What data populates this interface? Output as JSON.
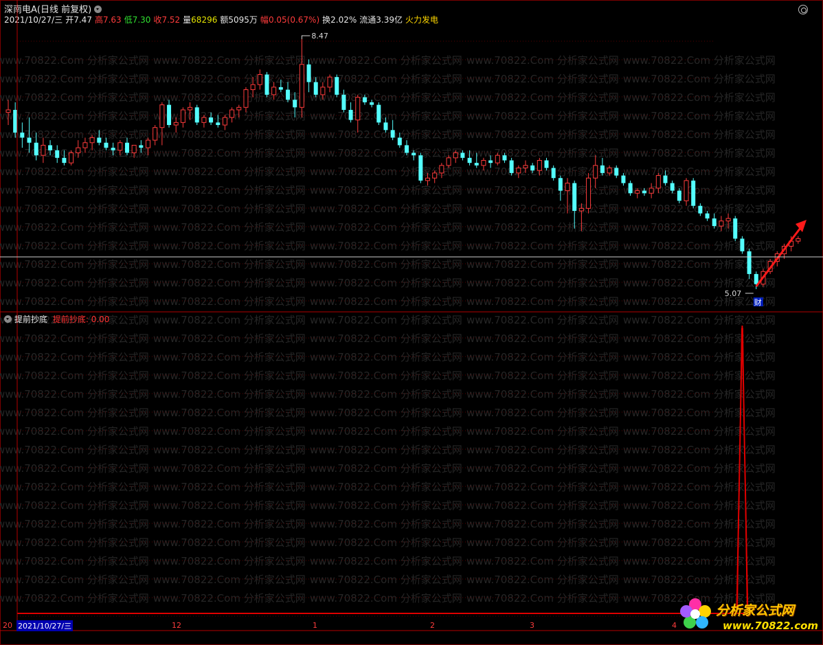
{
  "window": {
    "title": "深南电A(日线 前复权)"
  },
  "info_bar": {
    "date": "2021/10/27/三",
    "open_label": "开",
    "open": "7.47",
    "high_label": "高",
    "high": "7.63",
    "low_label": "低",
    "low": "7.30",
    "close_label": "收",
    "close": "7.52",
    "volume_label": "量",
    "volume": "68296",
    "amount_label": "额",
    "amount": "5095万",
    "change_label": "幅",
    "change": "0.05(0.67%)",
    "turnover_label": "换",
    "turnover": "2.02%",
    "float_label": "流通",
    "float_value": "3.39亿",
    "sector": "火力发电"
  },
  "price_chart": {
    "max_marker": "8.47",
    "min_marker": "5.07",
    "event_badge": "财"
  },
  "indicator": {
    "name": "提前抄底",
    "value_label": "提前抄底:",
    "value": "0.00"
  },
  "time_axis": {
    "cursor_date": "2021/10/27/三",
    "left_stub": "20",
    "month_labels": [
      "12",
      "1",
      "2",
      "3",
      "4"
    ]
  },
  "watermark": {
    "text": "www.70822.Com 分析家公式网"
  },
  "logo": {
    "brand": "分析家公式网",
    "url": "www.70822.com"
  },
  "colors": {
    "up": "#ff3c3c",
    "down": "#54ffff",
    "frame": "#b40000",
    "indicator_line": "#e00000"
  },
  "chart_data": {
    "type": "candlestick",
    "note_units": "price-chart y in price-scale units 0-100 (top=100); x in 0-1000 slots",
    "candles": [
      {
        "o": 68,
        "h": 73,
        "l": 63,
        "c": 69
      },
      {
        "o": 69,
        "h": 72,
        "l": 58,
        "c": 60
      },
      {
        "o": 60,
        "h": 64,
        "l": 54,
        "c": 58
      },
      {
        "o": 58,
        "h": 66,
        "l": 52,
        "c": 56
      },
      {
        "o": 56,
        "h": 60,
        "l": 49,
        "c": 51
      },
      {
        "o": 51,
        "h": 58,
        "l": 48,
        "c": 55
      },
      {
        "o": 55,
        "h": 57,
        "l": 51,
        "c": 53
      },
      {
        "o": 53,
        "h": 55,
        "l": 48,
        "c": 50
      },
      {
        "o": 50,
        "h": 53,
        "l": 47,
        "c": 48
      },
      {
        "o": 48,
        "h": 53,
        "l": 47,
        "c": 52
      },
      {
        "o": 52,
        "h": 57,
        "l": 50,
        "c": 54
      },
      {
        "o": 54,
        "h": 58,
        "l": 52,
        "c": 56
      },
      {
        "o": 56,
        "h": 59,
        "l": 53,
        "c": 58
      },
      {
        "o": 58,
        "h": 61,
        "l": 55,
        "c": 56
      },
      {
        "o": 56,
        "h": 58,
        "l": 53,
        "c": 54
      },
      {
        "o": 54,
        "h": 56,
        "l": 51,
        "c": 53
      },
      {
        "o": 53,
        "h": 57,
        "l": 51,
        "c": 56
      },
      {
        "o": 56,
        "h": 58,
        "l": 51,
        "c": 52
      },
      {
        "o": 52,
        "h": 55,
        "l": 50,
        "c": 55
      },
      {
        "o": 55,
        "h": 57,
        "l": 52,
        "c": 54
      },
      {
        "o": 54,
        "h": 58,
        "l": 51,
        "c": 57
      },
      {
        "o": 57,
        "h": 63,
        "l": 55,
        "c": 62
      },
      {
        "o": 62,
        "h": 72,
        "l": 55,
        "c": 71
      },
      {
        "o": 71,
        "h": 73,
        "l": 62,
        "c": 63
      },
      {
        "o": 63,
        "h": 66,
        "l": 60,
        "c": 64
      },
      {
        "o": 64,
        "h": 70,
        "l": 62,
        "c": 69
      },
      {
        "o": 69,
        "h": 72,
        "l": 65,
        "c": 70
      },
      {
        "o": 70,
        "h": 71,
        "l": 63,
        "c": 64
      },
      {
        "o": 64,
        "h": 67,
        "l": 62,
        "c": 66
      },
      {
        "o": 66,
        "h": 68,
        "l": 63,
        "c": 64
      },
      {
        "o": 64,
        "h": 67,
        "l": 62,
        "c": 63
      },
      {
        "o": 63,
        "h": 67,
        "l": 61,
        "c": 66
      },
      {
        "o": 66,
        "h": 70,
        "l": 64,
        "c": 69
      },
      {
        "o": 69,
        "h": 71,
        "l": 66,
        "c": 70
      },
      {
        "o": 70,
        "h": 78,
        "l": 68,
        "c": 77
      },
      {
        "o": 77,
        "h": 82,
        "l": 74,
        "c": 79
      },
      {
        "o": 79,
        "h": 85,
        "l": 77,
        "c": 83
      },
      {
        "o": 83,
        "h": 84,
        "l": 74,
        "c": 75
      },
      {
        "o": 75,
        "h": 80,
        "l": 73,
        "c": 78
      },
      {
        "o": 78,
        "h": 81,
        "l": 76,
        "c": 77
      },
      {
        "o": 77,
        "h": 80,
        "l": 72,
        "c": 73
      },
      {
        "o": 73,
        "h": 76,
        "l": 66,
        "c": 70
      },
      {
        "o": 70,
        "h": 97,
        "l": 66,
        "c": 87
      },
      {
        "o": 87,
        "h": 89,
        "l": 76,
        "c": 80
      },
      {
        "o": 80,
        "h": 82,
        "l": 74,
        "c": 75
      },
      {
        "o": 75,
        "h": 80,
        "l": 73,
        "c": 78
      },
      {
        "o": 78,
        "h": 83,
        "l": 76,
        "c": 82
      },
      {
        "o": 82,
        "h": 83,
        "l": 74,
        "c": 75
      },
      {
        "o": 75,
        "h": 77,
        "l": 68,
        "c": 69
      },
      {
        "o": 69,
        "h": 72,
        "l": 64,
        "c": 65
      },
      {
        "o": 65,
        "h": 75,
        "l": 60,
        "c": 74
      },
      {
        "o": 74,
        "h": 75,
        "l": 71,
        "c": 72
      },
      {
        "o": 72,
        "h": 73,
        "l": 70,
        "c": 71
      },
      {
        "o": 71,
        "h": 72,
        "l": 63,
        "c": 64
      },
      {
        "o": 64,
        "h": 66,
        "l": 60,
        "c": 61
      },
      {
        "o": 61,
        "h": 65,
        "l": 57,
        "c": 58
      },
      {
        "o": 58,
        "h": 60,
        "l": 54,
        "c": 55
      },
      {
        "o": 55,
        "h": 57,
        "l": 51,
        "c": 52
      },
      {
        "o": 52,
        "h": 53,
        "l": 49,
        "c": 51
      },
      {
        "o": 51,
        "h": 52,
        "l": 40,
        "c": 41
      },
      {
        "o": 41,
        "h": 44,
        "l": 39,
        "c": 42
      },
      {
        "o": 42,
        "h": 45,
        "l": 40,
        "c": 44
      },
      {
        "o": 44,
        "h": 48,
        "l": 42,
        "c": 47
      },
      {
        "o": 47,
        "h": 51,
        "l": 46,
        "c": 50
      },
      {
        "o": 50,
        "h": 53,
        "l": 48,
        "c": 52
      },
      {
        "o": 52,
        "h": 53,
        "l": 49,
        "c": 50
      },
      {
        "o": 50,
        "h": 53,
        "l": 47,
        "c": 48
      },
      {
        "o": 48,
        "h": 52,
        "l": 46,
        "c": 47
      },
      {
        "o": 47,
        "h": 50,
        "l": 45,
        "c": 49
      },
      {
        "o": 49,
        "h": 51,
        "l": 46,
        "c": 48
      },
      {
        "o": 48,
        "h": 52,
        "l": 47,
        "c": 51
      },
      {
        "o": 51,
        "h": 52,
        "l": 48,
        "c": 49
      },
      {
        "o": 49,
        "h": 50,
        "l": 43,
        "c": 44
      },
      {
        "o": 44,
        "h": 47,
        "l": 42,
        "c": 46
      },
      {
        "o": 46,
        "h": 49,
        "l": 44,
        "c": 47
      },
      {
        "o": 47,
        "h": 48,
        "l": 44,
        "c": 45
      },
      {
        "o": 45,
        "h": 50,
        "l": 43,
        "c": 49
      },
      {
        "o": 49,
        "h": 50,
        "l": 45,
        "c": 46
      },
      {
        "o": 46,
        "h": 47,
        "l": 41,
        "c": 42
      },
      {
        "o": 42,
        "h": 43,
        "l": 33,
        "c": 37
      },
      {
        "o": 37,
        "h": 42,
        "l": 28,
        "c": 40
      },
      {
        "o": 40,
        "h": 41,
        "l": 22,
        "c": 29
      },
      {
        "o": 29,
        "h": 32,
        "l": 21,
        "c": 30
      },
      {
        "o": 30,
        "h": 44,
        "l": 28,
        "c": 42
      },
      {
        "o": 42,
        "h": 51,
        "l": 38,
        "c": 47
      },
      {
        "o": 47,
        "h": 50,
        "l": 43,
        "c": 44
      },
      {
        "o": 44,
        "h": 47,
        "l": 43,
        "c": 46
      },
      {
        "o": 46,
        "h": 47,
        "l": 42,
        "c": 43
      },
      {
        "o": 43,
        "h": 44,
        "l": 39,
        "c": 40
      },
      {
        "o": 40,
        "h": 41,
        "l": 35,
        "c": 36
      },
      {
        "o": 36,
        "h": 38,
        "l": 34,
        "c": 37
      },
      {
        "o": 37,
        "h": 38,
        "l": 35,
        "c": 36
      },
      {
        "o": 36,
        "h": 40,
        "l": 34,
        "c": 38
      },
      {
        "o": 38,
        "h": 44,
        "l": 36,
        "c": 43
      },
      {
        "o": 43,
        "h": 45,
        "l": 39,
        "c": 40
      },
      {
        "o": 40,
        "h": 41,
        "l": 36,
        "c": 37
      },
      {
        "o": 37,
        "h": 38,
        "l": 32,
        "c": 33
      },
      {
        "o": 33,
        "h": 42,
        "l": 31,
        "c": 41
      },
      {
        "o": 41,
        "h": 42,
        "l": 30,
        "c": 31
      },
      {
        "o": 31,
        "h": 32,
        "l": 27,
        "c": 28
      },
      {
        "o": 28,
        "h": 29,
        "l": 25,
        "c": 26
      },
      {
        "o": 26,
        "h": 28,
        "l": 22,
        "c": 23
      },
      {
        "o": 23,
        "h": 27,
        "l": 21,
        "c": 25
      },
      {
        "o": 25,
        "h": 28,
        "l": 22,
        "c": 26
      },
      {
        "o": 26,
        "h": 27,
        "l": 17,
        "c": 18
      },
      {
        "o": 18,
        "h": 19,
        "l": 12,
        "c": 13
      },
      {
        "o": 13,
        "h": 14,
        "l": 2,
        "c": 4
      },
      {
        "o": 4,
        "h": 5,
        "l": -2,
        "c": 0
      },
      {
        "o": 0,
        "h": 6,
        "l": -1,
        "c": 5
      },
      {
        "o": 5,
        "h": 10,
        "l": 4,
        "c": 9
      },
      {
        "o": 9,
        "h": 13,
        "l": 7,
        "c": 12
      },
      {
        "o": 12,
        "h": 16,
        "l": 10,
        "c": 15
      },
      {
        "o": 15,
        "h": 19,
        "l": 13,
        "c": 17
      },
      {
        "o": 17,
        "h": 19,
        "l": 16,
        "c": 18
      }
    ],
    "indicator_series": {
      "name": "提前抄底",
      "values_note": "zero everywhere except a single spike near the last bars",
      "spike_index": 105,
      "spike_height": 1.0
    }
  }
}
